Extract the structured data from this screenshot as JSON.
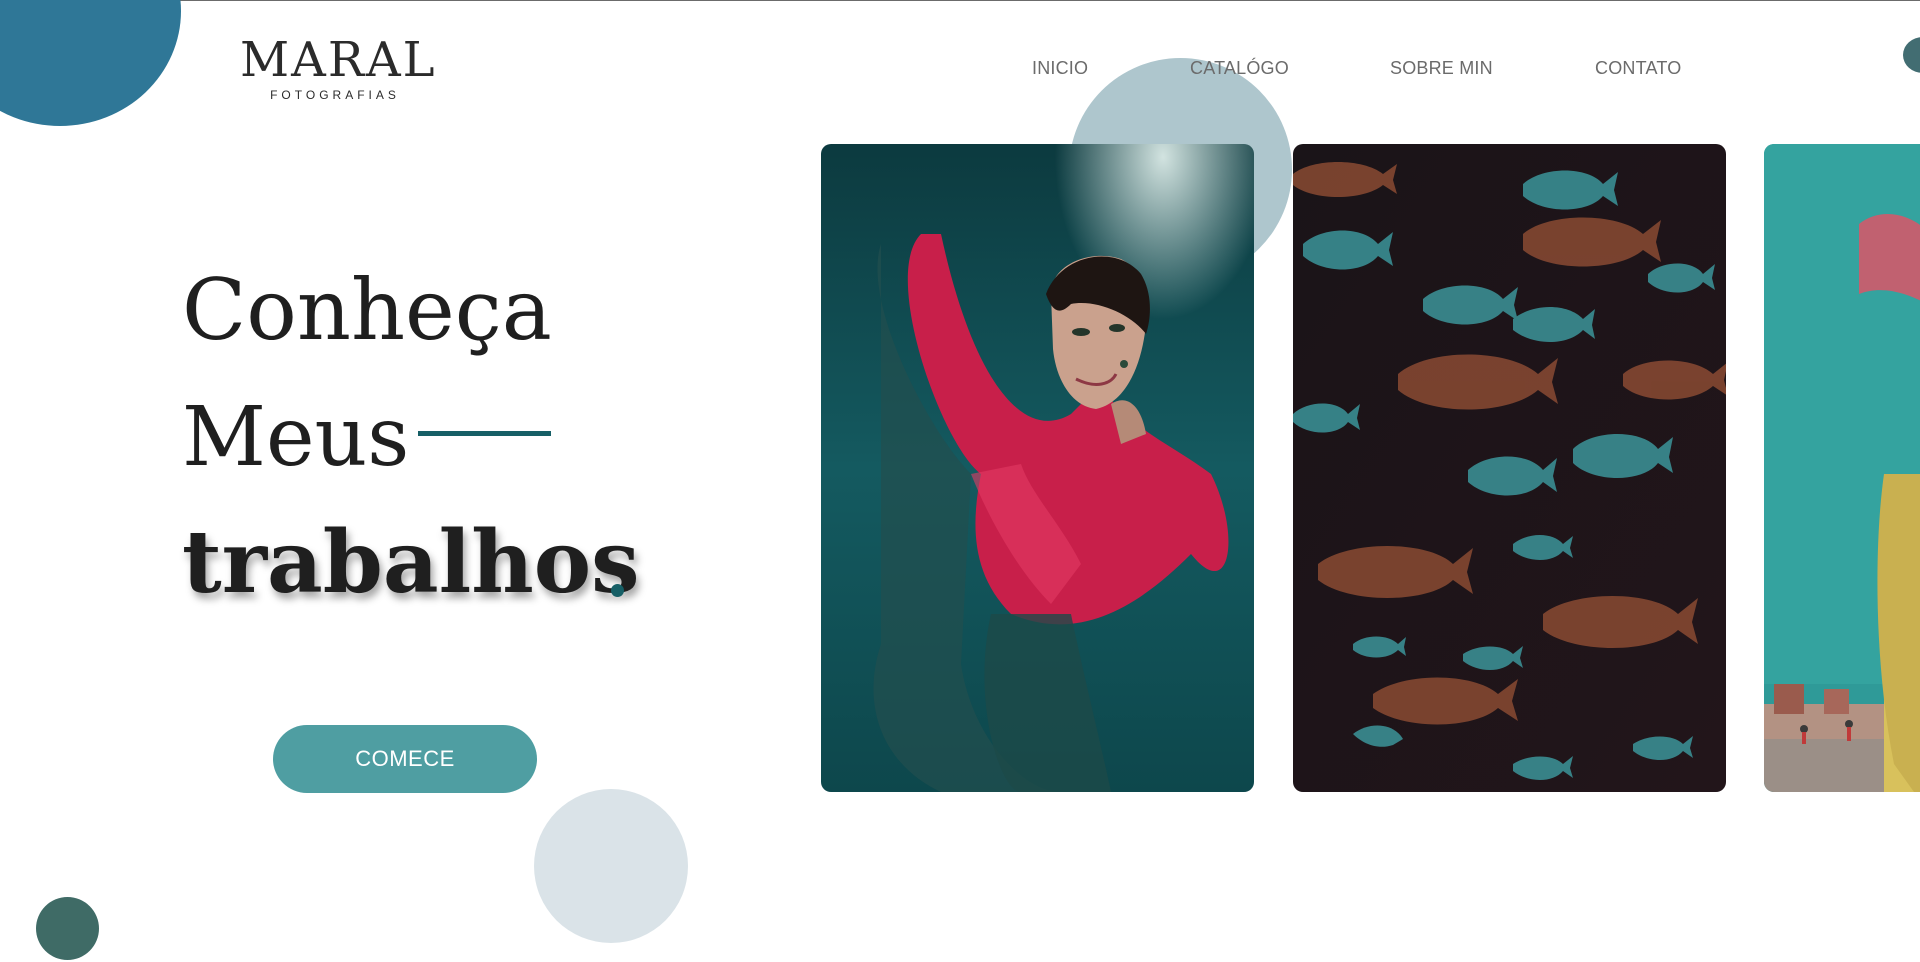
{
  "brand": {
    "name": "MARAL",
    "tagline": "FOTOGRAFIAS"
  },
  "nav": {
    "items": [
      "INICIO",
      "CATALÓGO",
      "SOBRE MIN",
      "CONTATO"
    ]
  },
  "hero": {
    "line1": "Conheça",
    "line2": "Meus",
    "line3": "trabalhos",
    "cta_label": "COMECE"
  },
  "gallery": [
    {
      "subject": "woman in red underwater"
    },
    {
      "subject": "school of fish"
    },
    {
      "subject": "colorful street portrait"
    }
  ],
  "colors": {
    "accent": "#165f66",
    "button": "#4f9ea2",
    "circle_blue": "#2f7797",
    "text_dark": "#1f1f1f",
    "nav_text": "#6b6b6b"
  }
}
